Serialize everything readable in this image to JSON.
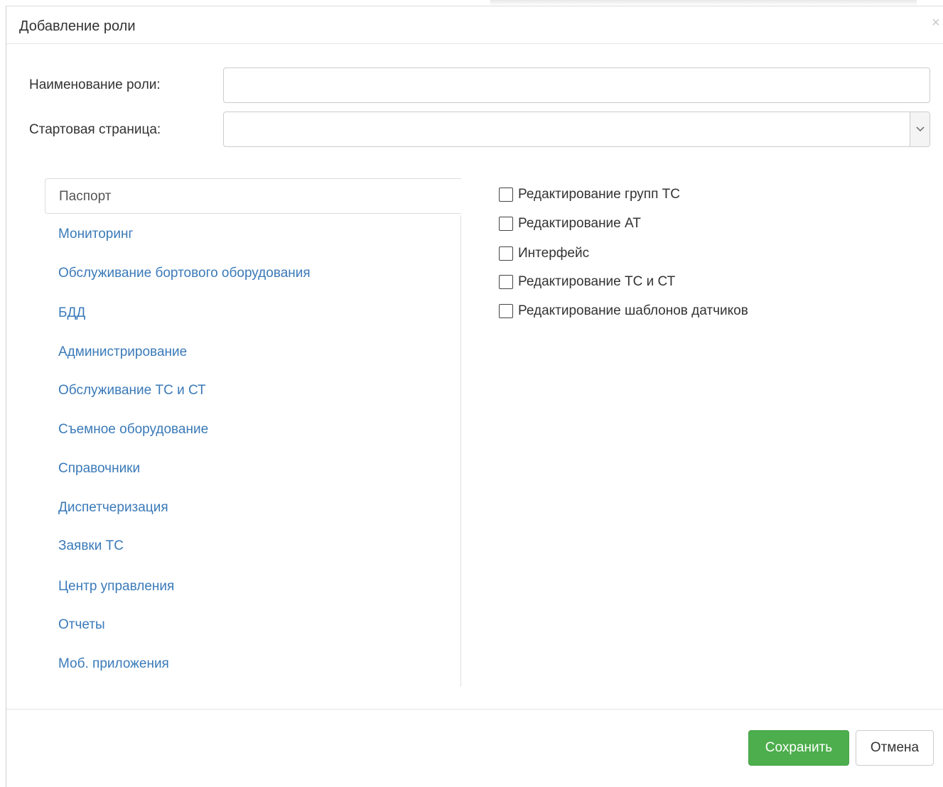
{
  "dialog": {
    "title": "Добавление роли",
    "close_symbol": "×"
  },
  "form": {
    "role_name_label": "Наименование роли:",
    "role_name_value": "",
    "start_page_label": "Стартовая страница:",
    "start_page_value": ""
  },
  "tabs": [
    {
      "label": "Паспорт",
      "active": true
    },
    {
      "label": "Мониторинг",
      "active": false
    },
    {
      "label": "Обслуживание бортового оборудования",
      "active": false
    },
    {
      "label": "БДД",
      "active": false
    },
    {
      "label": "Администрирование",
      "active": false
    },
    {
      "label": "Обслуживание ТС и СТ",
      "active": false
    },
    {
      "label": "Съемное оборудование",
      "active": false
    },
    {
      "label": "Справочники",
      "active": false
    },
    {
      "label": "Диспетчеризация",
      "active": false
    },
    {
      "label": "Заявки ТС",
      "active": false
    },
    {
      "label": "Центр управления",
      "active": false
    },
    {
      "label": "Отчеты",
      "active": false
    },
    {
      "label": "Моб. приложения",
      "active": false
    }
  ],
  "permissions": [
    {
      "label": "Редактирование групп ТС",
      "checked": false
    },
    {
      "label": "Редактирование АТ",
      "checked": false
    },
    {
      "label": "Интерфейс",
      "checked": false
    },
    {
      "label": "Редактирование ТС и СТ",
      "checked": false
    },
    {
      "label": "Редактирование шаблонов датчиков",
      "checked": false
    }
  ],
  "footer": {
    "save_label": "Сохранить",
    "cancel_label": "Отмена"
  },
  "colors": {
    "link": "#3a7ab8",
    "save_button": "#4cae4c"
  }
}
